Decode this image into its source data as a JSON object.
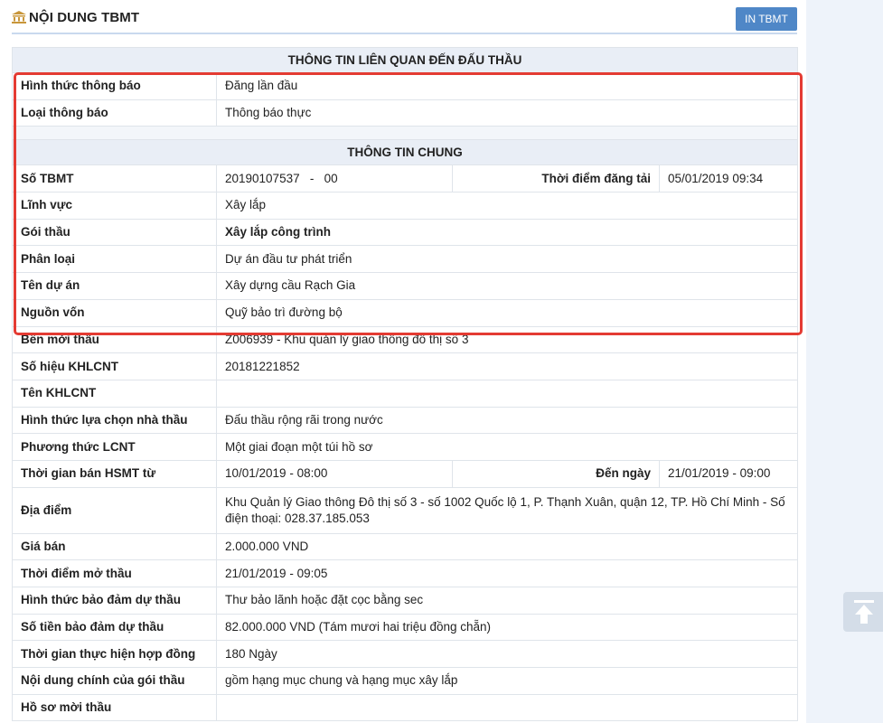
{
  "header": {
    "title": "NỘI DUNG TBMT",
    "print_button": "IN TBMT",
    "title_icon": "bank-icon"
  },
  "sections": {
    "bid_info": "THÔNG TIN LIÊN QUAN ĐẾN ĐẤU THẦU",
    "general_info": "THÔNG TIN CHUNG"
  },
  "rows": {
    "notice_form": {
      "label": "Hình thức thông báo",
      "value": "Đăng lần đầu"
    },
    "notice_type": {
      "label": "Loại thông báo",
      "value": "Thông báo thực"
    },
    "tbmt_no": {
      "label": "Số TBMT",
      "value": "20190107537   -   00",
      "extra_label": "Thời điểm đăng tải",
      "extra_value": "05/01/2019 09:34"
    },
    "field": {
      "label": "Lĩnh vực",
      "value": "Xây lắp"
    },
    "package": {
      "label": "Gói thầu",
      "value": "Xây lắp công trình"
    },
    "classification": {
      "label": "Phân loại",
      "value": "Dự án đầu tư phát triển"
    },
    "project_name": {
      "label": "Tên dự án",
      "value": "Xây dựng cầu Rạch Gia"
    },
    "funding": {
      "label": "Nguồn vốn",
      "value": "Quỹ bảo trì đường bộ"
    },
    "inviting_party": {
      "label": "Bên mời thầu",
      "value": "Z006939 - Khu quản lý giao thông đô thị số 3"
    },
    "plan_no": {
      "label": "Số hiệu KHLCNT",
      "value": "20181221852"
    },
    "plan_name": {
      "label": "Tên KHLCNT",
      "value": ""
    },
    "selection_form": {
      "label": "Hình thức lựa chọn nhà thầu",
      "value": "Đấu thầu rộng rãi trong nước"
    },
    "selection_method": {
      "label": "Phương thức LCNT",
      "value": "Một giai đoạn một túi hồ sơ"
    },
    "sale_period": {
      "label": "Thời gian bán HSMT từ",
      "value": "10/01/2019 - 08:00",
      "extra_label": "Đến ngày",
      "extra_value": "21/01/2019 - 09:00"
    },
    "location": {
      "label": "Địa điểm",
      "value": "Khu Quản lý Giao thông Đô thị số 3 - số 1002 Quốc lộ 1, P. Thạnh Xuân, quận 12, TP. Hồ Chí Minh - Số điện thoại: 028.37.185.053"
    },
    "price": {
      "label": "Giá bán",
      "value": "2.000.000 VND"
    },
    "opening_time": {
      "label": "Thời điểm mở thầu",
      "value": "21/01/2019 - 09:05"
    },
    "guarantee_form": {
      "label": "Hình thức bảo đảm dự thầu",
      "value": "Thư bảo lãnh hoặc đặt cọc bằng sec"
    },
    "guarantee_amount": {
      "label": "Số tiền bảo đảm dự thầu",
      "value": "82.000.000 VND (Tám mươi hai triệu đồng chẵn)"
    },
    "duration": {
      "label": "Thời gian thực hiện hợp đồng",
      "value": "180 Ngày"
    },
    "main_content": {
      "label": "Nội dung chính của gói thầu",
      "value": "gồm hạng mục chung và hạng mục xây lắp"
    },
    "documents": {
      "label": "Hồ sơ mời thầu",
      "value": ""
    }
  },
  "colors": {
    "section_bg": "#e9eef6",
    "highlight": "#e43b33",
    "button": "#4f87c7"
  },
  "scroll_top_icon": "arrow-up-to-top-icon"
}
